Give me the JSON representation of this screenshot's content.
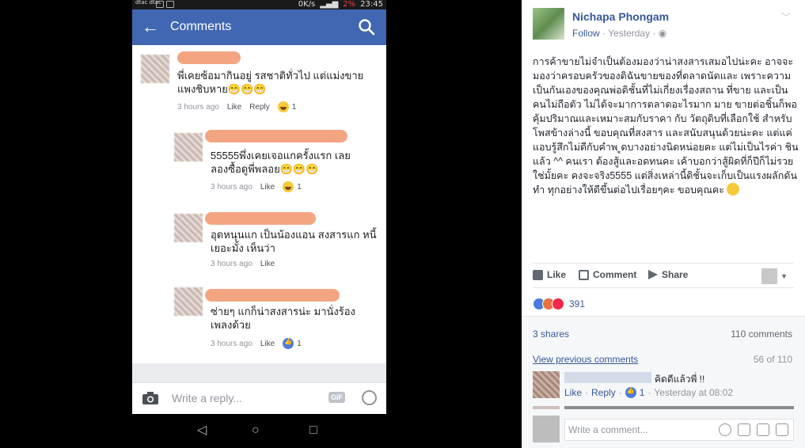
{
  "phone": {
    "status": {
      "carrier": "dtac\ndtac",
      "speed": "0K/s",
      "battery": "2%",
      "time": "23:45"
    },
    "appbar": {
      "title": "Comments"
    },
    "comments": [
      {
        "text": "พี่เคยซ้อมากินอยู่ รสชาติทั่วไป แต่แม่งขาย แพงชิบหาย😁😁😁",
        "time": "3 hours ago",
        "like": "Like",
        "reply": "Reply",
        "reactions": "1"
      },
      {
        "text": "55555พึ่งเคยเจอแกครั้งแรก เลย ลองซื้อดูพี่พลอย😁😁😁",
        "time": "3 hours ago",
        "like": "Like",
        "reactions": "1"
      },
      {
        "text": "อุดหนุนแก เป็นน้องแอน สงสารแก หนี้ เยอะมั้ง เห็นว่า",
        "time": "3 hours ago",
        "like": "Like"
      },
      {
        "text": "ซ่ายๆ แกก็น่าสงสารน่ะ มานั่งร้อง เพลงด้วย",
        "time": "3 hours ago",
        "like": "Like",
        "reactions": "1"
      }
    ],
    "reply_placeholder": "Write a reply...",
    "gif": "GIF"
  },
  "post": {
    "author": "Nichapa Phongam",
    "follow": "Follow",
    "time": "Yesterday",
    "body": "การค้าขายไม่จำเป็นต้องมองว่าน่าสงสารเสมอไปน่ะคะ อาจจะมองว่าครอบครัวของดิฉันขายของที่ตลาดนัดและ เพราะความเป็นกันเองของคุณพ่อดิชั้นที่ไม่เกี่ยงเรื่องสถาน ที่ขาย และเป็นคนไม่ถือตัว ไม่ได้จะมาการตลาดอะไรมาก มาย ขายต่อชิ้นก็พอคุ้มปริมาณและเหมาะสมกับราคา กับ วัตถุดิบที่เลือกใช้ สำหรับโพสข้างล่างนี้ ขอบคุณที่สงสาร และสนับสนุนด้วยน่ะคะ แต่แค่แอบรู้สึกไม่ดีกับคำพ ูดบางอย่างนิดหน่อยคะ แต่ไม่เป็นไรค่า ชินแล้ว ^^ คนเรา ต้องสู้และอดทนคะ เค้าบอกว่าสู้ผิดที่ก็ปีก็ไม่รวยใช่มั้ยคะ คงจะจริง5555 แต่สิ่งเหล่านี้ดิชั้นจะเก็บเป็นแรงผลักดันทำ ทุกอย่างให้ดีขึ้นต่อไปเรื่อยๆคะ ขอบคุณคะ",
    "actions": {
      "like": "Like",
      "comment": "Comment",
      "share": "Share"
    },
    "reaction_count": "391",
    "shares": "3 shares",
    "comments_count": "110 comments",
    "view_previous": "View previous comments",
    "page_count": "56 of 110",
    "comment": {
      "text": "คิดดีแล้วพี่ !!",
      "like": "Like",
      "reply": "Reply",
      "reactions": "1",
      "time": "Yesterday at 08:02"
    },
    "write_placeholder": "Write a comment..."
  }
}
